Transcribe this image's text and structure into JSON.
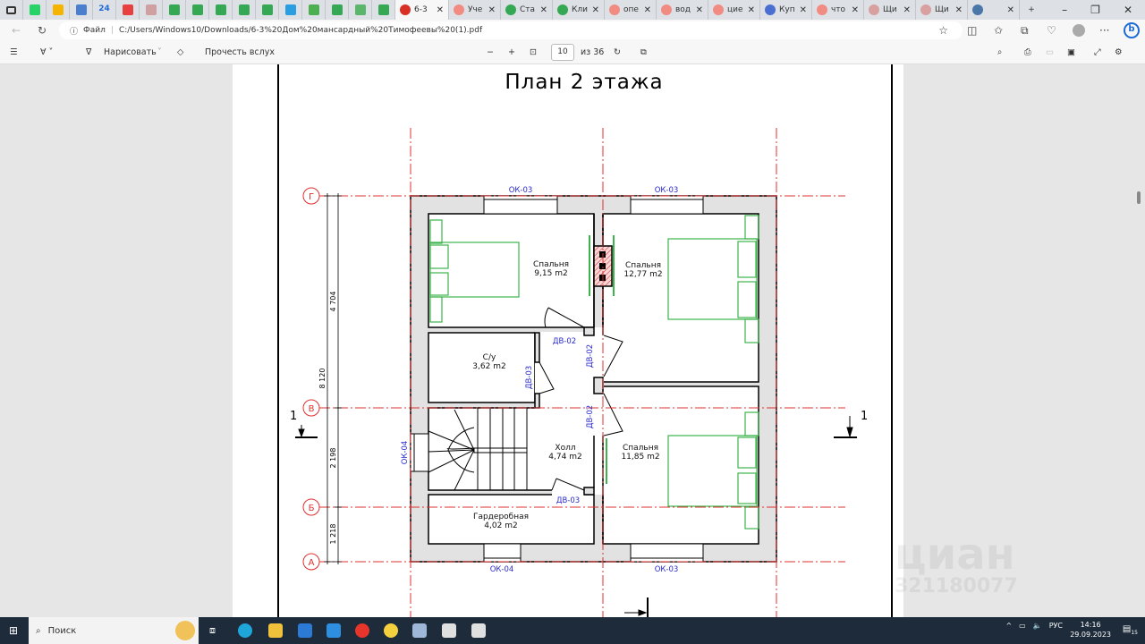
{
  "browser": {
    "pinned_tabs": [
      {
        "icon": "whatsapp-icon",
        "color": "#25d366"
      },
      {
        "icon": "drive-icon",
        "color": "#f4b400"
      },
      {
        "icon": "a-icon",
        "color": "#4a7fd0"
      },
      {
        "icon": "24-icon",
        "color": "#1e6bd6",
        "text": "24"
      },
      {
        "icon": "red-circle-icon",
        "color": "#e84040"
      },
      {
        "icon": "gmail-icon",
        "color": "#d0a0a0"
      },
      {
        "icon": "sheet-icon",
        "color": "#34a853"
      },
      {
        "icon": "sheet-icon",
        "color": "#34a853"
      },
      {
        "icon": "sheet-icon",
        "color": "#34a853"
      },
      {
        "icon": "sheet-icon",
        "color": "#34a853"
      },
      {
        "icon": "sheet-icon",
        "color": "#34a853"
      },
      {
        "icon": "telegram-icon",
        "color": "#2a9ee0"
      },
      {
        "icon": "refresh-app-icon",
        "color": "#4caf50"
      },
      {
        "icon": "sheet-icon",
        "color": "#34a853"
      },
      {
        "icon": "green-circle-icon",
        "color": "#5bb56a"
      },
      {
        "icon": "sheet-icon",
        "color": "#34a853"
      }
    ],
    "tabs": [
      {
        "label": "6-3",
        "icon": "pdf-icon",
        "color": "#d93025",
        "active": true
      },
      {
        "label": "Уче",
        "color": "#f28b82"
      },
      {
        "label": "Ста",
        "color": "#34a853"
      },
      {
        "label": "Кли",
        "color": "#34a853"
      },
      {
        "label": "опе",
        "color": "#f28b82"
      },
      {
        "label": "вод",
        "color": "#f28b82"
      },
      {
        "label": "цие",
        "color": "#f28b82"
      },
      {
        "label": "Куп",
        "color": "#4a6fd0"
      },
      {
        "label": "что",
        "color": "#f28b82"
      },
      {
        "label": "Щи",
        "color": "#d9a0a0"
      },
      {
        "label": "Щи",
        "color": "#d9a0a0"
      },
      {
        "label": "",
        "color": "#4a76a8"
      }
    ],
    "new_tab": "+",
    "file_label": "Файл",
    "url": "C:/Users/Windows10/Downloads/6-3%20Дом%20мансардный%20Тимофеевы%20(1).pdf"
  },
  "pdf_toolbar": {
    "draw": "Нарисовать",
    "read_aloud": "Прочесть вслух",
    "page": "10",
    "of_pages": "из 36"
  },
  "plan": {
    "title": "План 2 этажа",
    "axes": [
      "Г",
      "В",
      "Б",
      "А"
    ],
    "dims": {
      "total": "8 120",
      "d1": "4 704",
      "d2": "2 198",
      "d3": "1 218"
    },
    "section": "1",
    "rooms": [
      {
        "name": "Спальня",
        "area": "9,15 m2"
      },
      {
        "name": "Спальня",
        "area": "12,77 m2"
      },
      {
        "name": "С/у",
        "area": "3,62 m2"
      },
      {
        "name": "Холл",
        "area": "4,74 m2"
      },
      {
        "name": "Спальня",
        "area": "11,85 m2"
      },
      {
        "name": "Гардеробная",
        "area": "4,02 m2"
      }
    ],
    "marks": {
      "ok03": "ОК-03",
      "ok04": "ОК-04",
      "dv02": "ДВ-02",
      "dv03": "ДВ-03"
    },
    "watermark": "циан",
    "watermark_id": "321180077",
    "colors": {
      "axis": "#e03030",
      "wall": "#e2e2e2",
      "furniture": "#3cb44b",
      "mark": "#2a2ad0"
    }
  },
  "taskbar": {
    "search": "Поиск",
    "lang": "РУС",
    "time": "14:16",
    "date": "29.09.2023",
    "notif": "15"
  }
}
